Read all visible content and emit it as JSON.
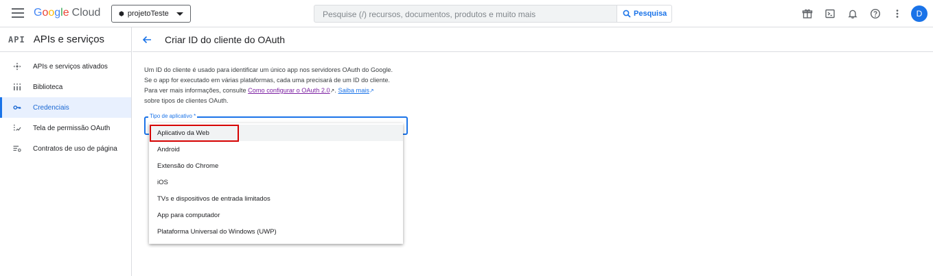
{
  "header": {
    "logo_letters": [
      "G",
      "o",
      "o",
      "g",
      "l",
      "e"
    ],
    "logo_cloud": "Cloud",
    "project_name": "projetoTeste",
    "search_placeholder": "Pesquise (/) recursos, documentos, produtos e muito mais",
    "search_button": "Pesquisa",
    "avatar_initial": "D",
    "icons": [
      "menu-icon",
      "gift-icon",
      "terminal-icon",
      "bell-icon",
      "help-icon",
      "more-vert-icon"
    ]
  },
  "sidebar": {
    "badge": "API",
    "title": "APIs e serviços",
    "items": [
      {
        "label": "APIs e serviços ativados",
        "icon": "enabled-apis-icon",
        "active": false
      },
      {
        "label": "Biblioteca",
        "icon": "library-icon",
        "active": false
      },
      {
        "label": "Credenciais",
        "icon": "key-icon",
        "active": true
      },
      {
        "label": "Tela de permissão OAuth",
        "icon": "consent-icon",
        "active": false
      },
      {
        "label": "Contratos de uso de página",
        "icon": "settings-list-icon",
        "active": false
      }
    ]
  },
  "main": {
    "title": "Criar ID do cliente do OAuth",
    "description": {
      "line1": "Um ID do cliente é usado para identificar um único app nos servidores OAuth do Google.",
      "line2": "Se o app for executado em várias plataformas, cada uma precisará de um ID do cliente.",
      "line3_prefix": "Para ver mais informações, consulte",
      "link1": "Como configurar o OAuth 2.0",
      "link2": "Saiba mais",
      "line4": "sobre tipos de clientes OAuth."
    },
    "field_label": "Tipo de aplicativo *",
    "options": [
      "Aplicativo da Web",
      "Android",
      "Extensão do Chrome",
      "iOS",
      "TVs e dispositivos de entrada limitados",
      "App para computador",
      "Plataforma Universal do Windows (UWP)"
    ]
  },
  "colors": {
    "accent": "#1a73e8",
    "highlight_box": "#d60000",
    "link_visited": "#7b1fa2"
  }
}
